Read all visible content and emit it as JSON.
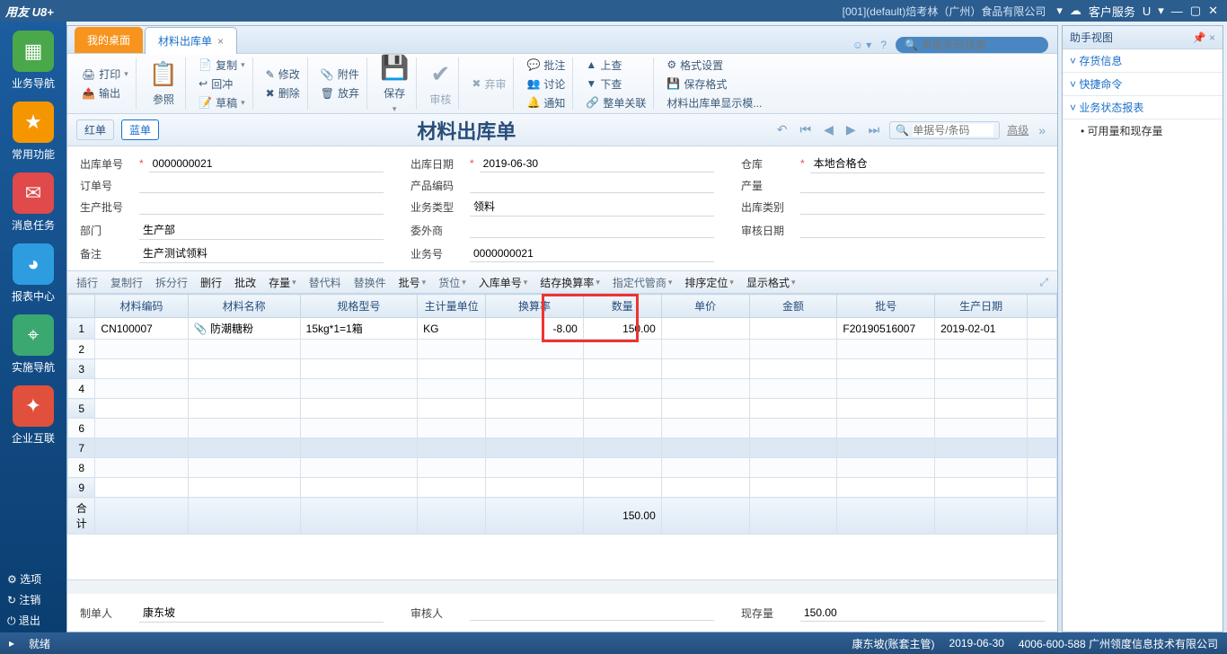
{
  "titlebar": {
    "logo": "用友 U8+",
    "company": "[001](default)焙考林（广州）食品有限公司",
    "service": "客户服务",
    "u": "U"
  },
  "sidebar": {
    "items": [
      {
        "label": "业务导航",
        "icon": "▦",
        "color": "#4aa84a"
      },
      {
        "label": "常用功能",
        "icon": "★",
        "color": "#f59600"
      },
      {
        "label": "消息任务",
        "icon": "✉",
        "color": "#e04a4a"
      },
      {
        "label": "报表中心",
        "icon": "◕",
        "color": "#2d9de0"
      },
      {
        "label": "实施导航",
        "icon": "⌖",
        "color": "#3aa870"
      },
      {
        "label": "企业互联",
        "icon": "✦",
        "color": "#e0503c"
      }
    ],
    "bottom": {
      "options": "选项",
      "logout": "注销",
      "exit": "退出"
    }
  },
  "tabs": {
    "desktop": "我的桌面",
    "active": "材料出库单"
  },
  "search": {
    "placeholder": "单据条码搜索"
  },
  "ribbon": {
    "print": "打印",
    "output": "输出",
    "ref": "参照",
    "copy": "复制",
    "back": "回冲",
    "draft": "草稿",
    "edit": "修改",
    "delete": "删除",
    "attach": "附件",
    "discard": "放弃",
    "save": "保存",
    "audit": "审核",
    "abandon": "弃审",
    "note": "批注",
    "discuss": "讨论",
    "notify": "通知",
    "up": "上查",
    "down": "下查",
    "related": "整单关联",
    "format": "格式设置",
    "saveformat": "保存格式",
    "display": "材料出库单显示模..."
  },
  "formbar": {
    "red": "红单",
    "blue": "蓝单",
    "title": "材料出库单",
    "searchph": "单据号/条码",
    "adv": "高级"
  },
  "fields": {
    "docno_lbl": "出库单号",
    "docno": "0000000021",
    "date_lbl": "出库日期",
    "date": "2019-06-30",
    "wh_lbl": "仓库",
    "wh": "本地合格仓",
    "order_lbl": "订单号",
    "prodcode_lbl": "产品编码",
    "qty_lbl": "产量",
    "batch_lbl": "生产批号",
    "biztype_lbl": "业务类型",
    "biztype": "领料",
    "outtype_lbl": "出库类别",
    "dept_lbl": "部门",
    "dept": "生产部",
    "outsrc_lbl": "委外商",
    "auditdate_lbl": "审核日期",
    "remark_lbl": "备注",
    "remark": "生产测试领料",
    "bizno_lbl": "业务号",
    "bizno": "0000000021"
  },
  "gridbar": {
    "insert": "插行",
    "copyrow": "复制行",
    "split": "拆分行",
    "delrow": "删行",
    "batch": "批改",
    "stock": "存量",
    "altmat": "替代料",
    "altpart": "替换件",
    "lot": "批号",
    "loc": "货位",
    "inbill": "入库单号",
    "carryrate": "结存换算率",
    "keeper": "指定代管商",
    "sort": "排序定位",
    "format": "显示格式"
  },
  "columns": {
    "code": "材料编码",
    "name": "材料名称",
    "spec": "规格型号",
    "unit": "主计量单位",
    "rate": "换算率",
    "qty": "数量",
    "price": "单价",
    "amt": "金额",
    "lot": "批号",
    "pdate": "生产日期"
  },
  "row": {
    "code": "CN100007",
    "name": "防潮糖粉",
    "spec": "15kg*1=1箱",
    "unit": "KG",
    "rate": "-8.00",
    "qty": "150.00",
    "lot": "F20190516007",
    "pdate": "2019-02-01"
  },
  "sum": {
    "label": "合计",
    "qty": "150.00"
  },
  "bottom": {
    "maker_lbl": "制单人",
    "maker": "康东坡",
    "auditor_lbl": "审核人",
    "stock_lbl": "现存量",
    "stock": "150.00"
  },
  "status": {
    "ready": "就绪",
    "user": "康东坡(账套主管)",
    "date": "2019-06-30",
    "phone": "4006-600-588 广州领度信息技术有限公司"
  },
  "rightpanel": {
    "title": "助手视图",
    "sec1": "存货信息",
    "sec2": "快捷命令",
    "sec3": "业务状态报表",
    "item1": "可用量和现存量"
  }
}
